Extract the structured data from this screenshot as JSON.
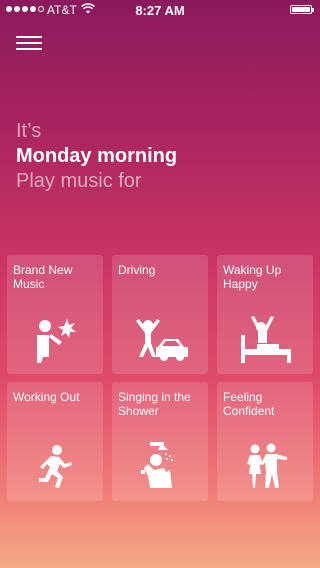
{
  "status_bar": {
    "carrier": "AT&T",
    "time": "8:27 AM",
    "signal_bars": 4,
    "battery_level": 1.0
  },
  "header": {
    "menu_icon": "hamburger-icon"
  },
  "headline": {
    "line1": "It’s",
    "line2": "Monday morning",
    "line3": "Play music for"
  },
  "tiles": [
    {
      "label": "Brand New Music",
      "icon": "person-holding-star-icon"
    },
    {
      "label": "Driving",
      "icon": "person-car-icon"
    },
    {
      "label": "Waking Up Happy",
      "icon": "person-in-bed-icon"
    },
    {
      "label": "Working Out",
      "icon": "running-person-icon"
    },
    {
      "label": "Singing in the Shower",
      "icon": "person-in-shower-icon"
    },
    {
      "label": "Feeling Confident",
      "icon": "confident-couple-icon"
    }
  ],
  "colors": {
    "gradient_top": "#8a1a5c",
    "gradient_mid": "#c93563",
    "gradient_bottom": "#f6ab86",
    "tile_background": "rgba(255,255,255,0.14)",
    "text": "#ffffff"
  }
}
